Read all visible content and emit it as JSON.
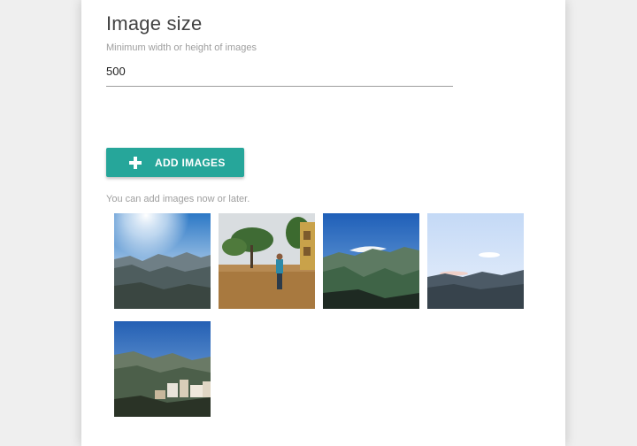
{
  "image_size": {
    "title": "Image size",
    "hint": "Minimum width or height of images",
    "value": "500"
  },
  "add_images": {
    "label": "ADD IMAGES",
    "icon": "plus-icon",
    "color": "#26a69a"
  },
  "note": "You can add images now or later.",
  "thumbnails": [
    {
      "subject": "mountain-sunburst"
    },
    {
      "subject": "flooded-street"
    },
    {
      "subject": "green-mountains"
    },
    {
      "subject": "pale-sky-ridge"
    },
    {
      "subject": "town-on-mountain"
    }
  ]
}
